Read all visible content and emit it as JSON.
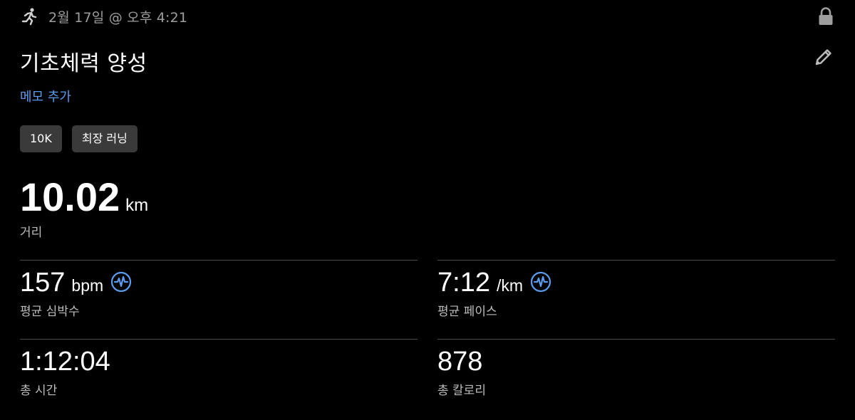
{
  "header": {
    "activity_icon": "running-person-icon",
    "timestamp": "2월 17일 @ 오후 4:21",
    "lock_icon": "lock-icon"
  },
  "title": "기초체력 양성",
  "edit_icon": "pencil-icon",
  "memo_link": "메모 추가",
  "tags": [
    "10K",
    "최장 러닝"
  ],
  "distance": {
    "value": "10.02",
    "unit": "km",
    "label": "거리"
  },
  "stats": {
    "heart_rate": {
      "value": "157",
      "unit": "bpm",
      "label": "평균 심박수",
      "icon": "heart-rate-chart-icon"
    },
    "pace": {
      "value": "7:12",
      "unit": "/km",
      "label": "평균 페이스",
      "icon": "pace-chart-icon"
    },
    "total_time": {
      "value": "1:12:04",
      "label": "총 시간"
    },
    "calories": {
      "value": "878",
      "label": "총 칼로리"
    }
  },
  "colors": {
    "background": "#000000",
    "accent": "#5c9cf0",
    "muted_text": "#9e9e9e",
    "tag_bg": "#3a3a3a"
  }
}
